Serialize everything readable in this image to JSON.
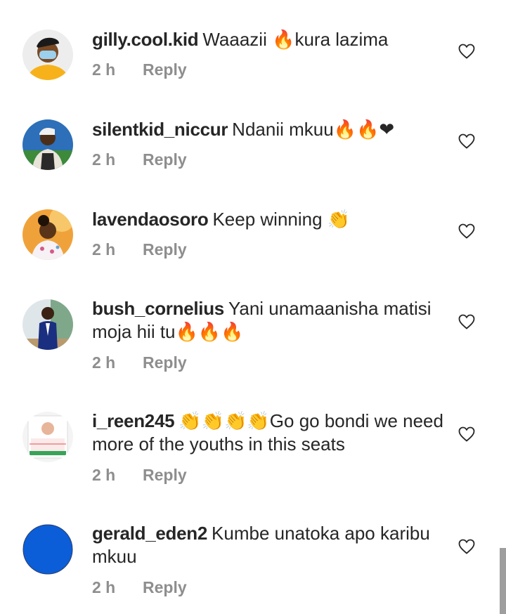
{
  "comments": [
    {
      "username": "gilly.cool.kid",
      "text": "Waaazii 🔥kura lazima",
      "time": "2 h",
      "reply": "Reply",
      "avatar": "masked-boy-yellow-shirt"
    },
    {
      "username": "silentkid_niccur",
      "text": "Ndanii mkuu🔥🔥❤",
      "time": "2 h",
      "reply": "Reply",
      "avatar": "man-in-vest-blue-bg"
    },
    {
      "username": "lavendaosoro",
      "text": "Keep winning 👏",
      "time": "2 h",
      "reply": "Reply",
      "avatar": "woman-floral-orange-bg"
    },
    {
      "username": "bush_cornelius",
      "text": "Yani unamaanisha matisi moja hii tu🔥🔥🔥",
      "time": "2 h",
      "reply": "Reply",
      "avatar": "man-in-suit"
    },
    {
      "username": "i_reen245",
      "text": "👏👏👏👏Go go bondi we need more of the youths in this seats",
      "time": "2 h",
      "reply": "Reply",
      "avatar": "help-poster"
    },
    {
      "username": "gerald_eden2",
      "text": "Kumbe unatoka apo karibu mkuu",
      "time": "2 h",
      "reply": "Reply",
      "avatar": "blue-circle"
    }
  ],
  "colors": {
    "username": "#262626",
    "meta": "#8e8e8e",
    "fire": "#f4900c",
    "heart_emoji": "#dd2e6b",
    "clap": "#fdcb58",
    "blue_avatar": "#0b5ed8"
  }
}
